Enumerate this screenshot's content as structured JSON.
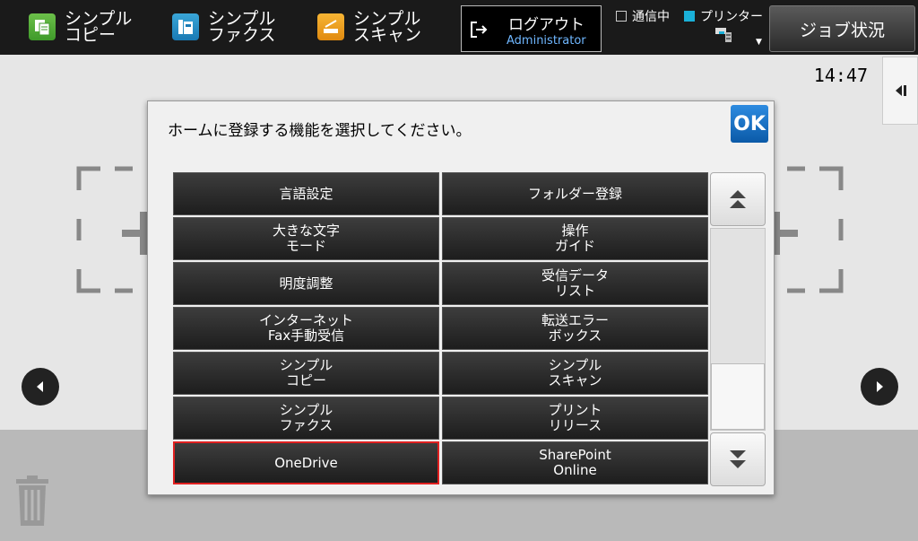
{
  "topbar": {
    "apps": [
      {
        "label": "シンプル\nコピー",
        "icon": "copy-icon"
      },
      {
        "label": "シンプル\nファクス",
        "icon": "fax-icon"
      },
      {
        "label": "シンプル\nスキャン",
        "icon": "scan-icon"
      }
    ],
    "logout": {
      "label": "ログアウト",
      "user": "Administrator"
    },
    "status": {
      "comm": "通信中",
      "printer": "プリンター"
    },
    "job_status": "ジョブ状況"
  },
  "clock": "14:47",
  "dialog": {
    "title": "ホームに登録する機能を選択してください。",
    "ok": "OK",
    "items": [
      {
        "label": "言語設定"
      },
      {
        "label": "フォルダー登録"
      },
      {
        "label": "大きな文字\nモード"
      },
      {
        "label": "操作\nガイド"
      },
      {
        "label": "明度調整"
      },
      {
        "label": "受信データ\nリスト"
      },
      {
        "label": "インターネット\nFax手動受信"
      },
      {
        "label": "転送エラー\nボックス"
      },
      {
        "label": "シンプル\nコピー"
      },
      {
        "label": "シンプル\nスキャン"
      },
      {
        "label": "シンプル\nファクス"
      },
      {
        "label": "プリント\nリリース"
      },
      {
        "label": "OneDrive"
      },
      {
        "label": "SharePoint\nOnline"
      }
    ],
    "selected_index": 12
  },
  "colors": {
    "accent": "#0b5aa8",
    "selected_border": "#e02020",
    "status_teal": "#1ab0d8"
  }
}
